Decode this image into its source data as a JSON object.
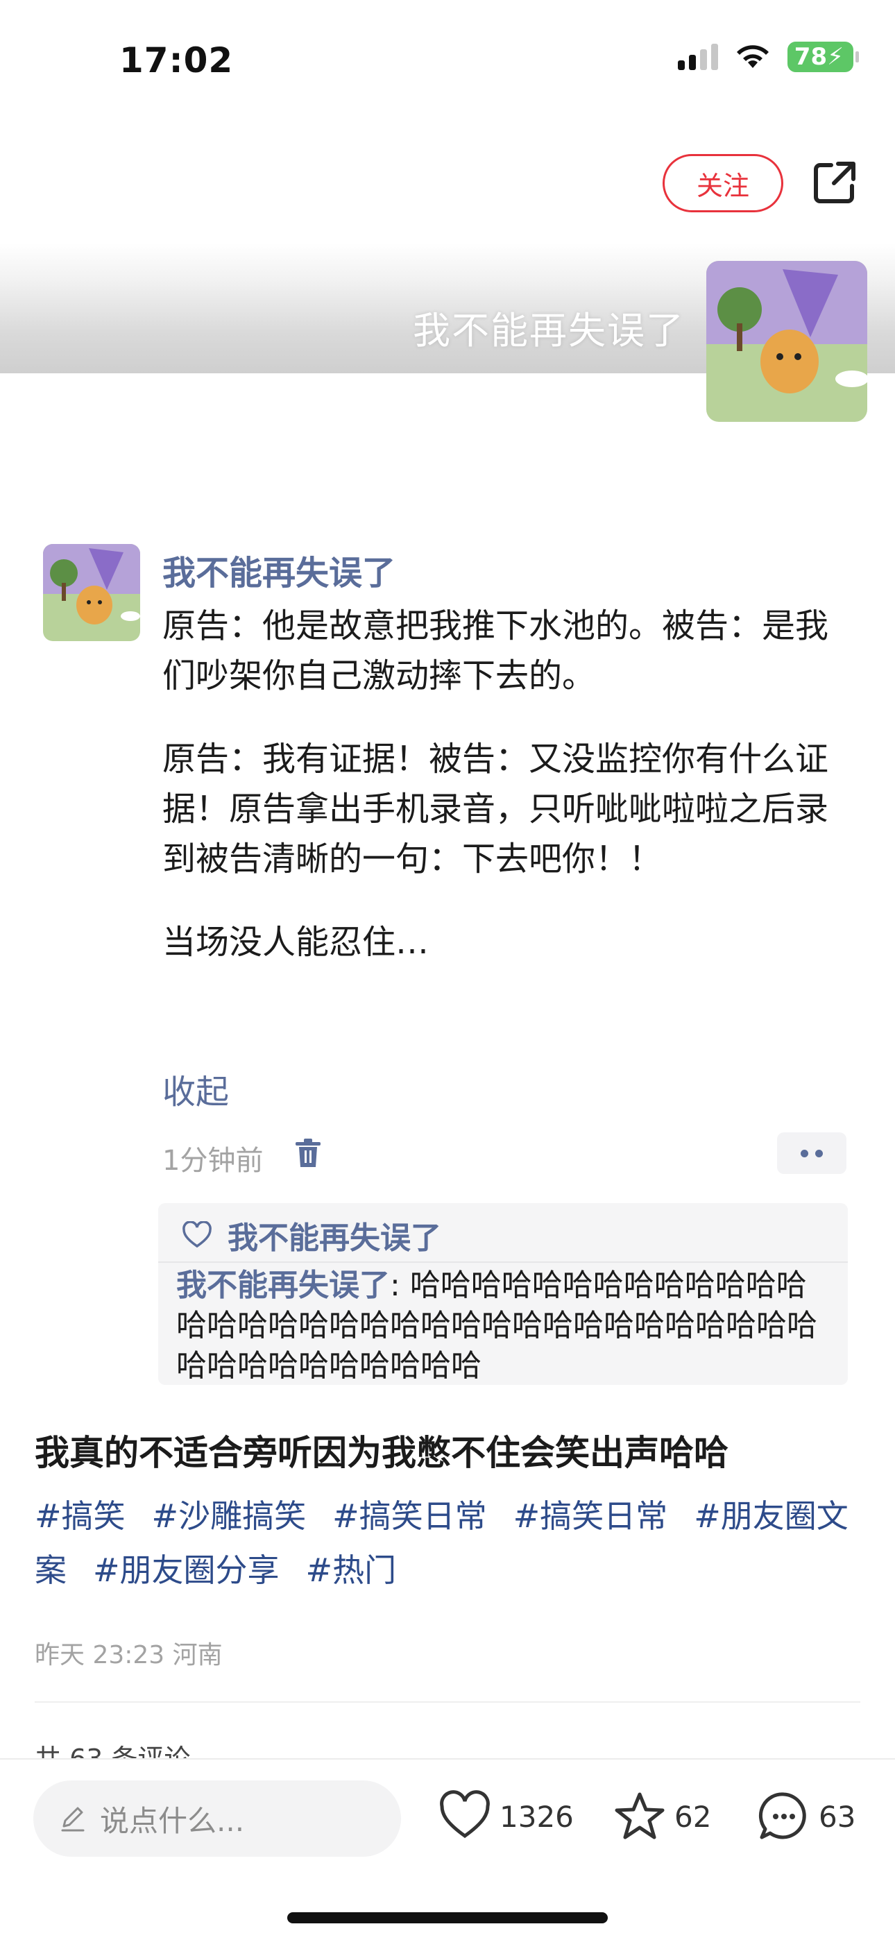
{
  "status_bar": {
    "time": "17:02",
    "battery": "78"
  },
  "header": {
    "follow_label": "关注"
  },
  "banner": {
    "title": "我不能再失误了"
  },
  "post": {
    "author": "我不能再失误了",
    "paragraphs": [
      "原告：他是故意把我推下水池的。被告：是我们吵架你自己激动摔下去的。",
      "原告：我有证据！被告：又没监控你有什么证据！原告拿出手机录音，只听呲呲啦啦之后录到被告清晰的一句：下去吧你！！",
      "当场没人能忍住…"
    ],
    "collapse_label": "收起",
    "time": "1分钟前",
    "likes": {
      "user": "我不能再失误了"
    },
    "comment": {
      "author": "我不能再失误了",
      "separator": ": ",
      "text": "哈哈哈哈哈哈哈哈哈哈哈哈哈哈哈哈哈哈哈哈哈哈哈哈哈哈哈哈哈哈哈哈哈哈哈哈哈哈哈哈哈哈哈哈"
    }
  },
  "note": {
    "caption": "我真的不适合旁听因为我憋不住会笑出声哈哈",
    "tags": [
      "#搞笑",
      "#沙雕搞笑",
      "#搞笑日常",
      "#搞笑日常",
      "#朋友圈文案",
      "#朋友圈分享",
      "#热门"
    ],
    "meta": "昨天 23:23 河南",
    "comments_total": "共 63 条评论"
  },
  "bottom_bar": {
    "input_placeholder": "说点什么...",
    "like_count": "1326",
    "favorite_count": "62",
    "comment_count": "63"
  },
  "colors": {
    "accent_red": "#e8323c",
    "link_blue": "#5a6d9a",
    "tag_blue": "#2d4b8a"
  }
}
